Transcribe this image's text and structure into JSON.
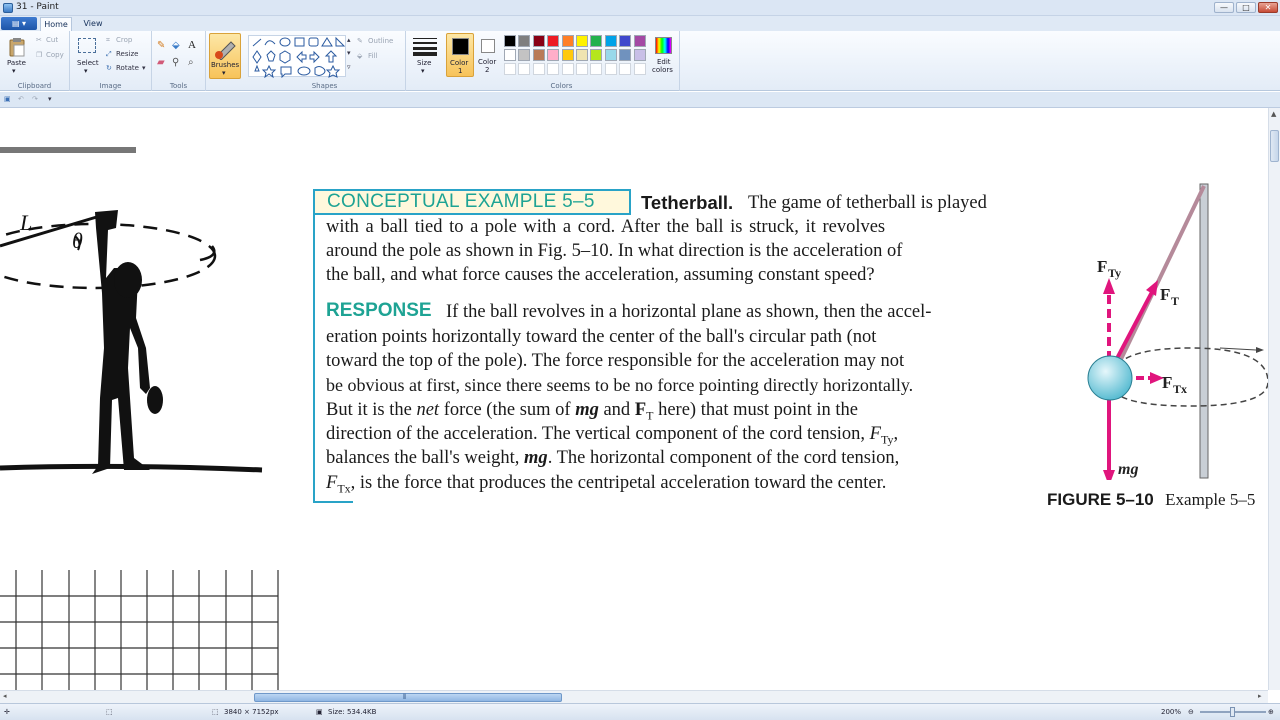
{
  "window": {
    "title": "31 - Paint",
    "minimize": "—",
    "maximize": "□",
    "close": "✕"
  },
  "tabs": [
    {
      "label": "Home",
      "active": true
    },
    {
      "label": "View",
      "active": false
    }
  ],
  "ribbon": {
    "clipboard": {
      "label": "Clipboard",
      "paste": "Paste",
      "cut": "Cut",
      "copy": "Copy"
    },
    "image": {
      "label": "Image",
      "select": "Select",
      "crop": "Crop",
      "resize": "Resize",
      "rotate": "Rotate"
    },
    "tools": {
      "label": "Tools"
    },
    "brushes": {
      "label": "Brushes"
    },
    "shapes": {
      "label": "Shapes",
      "outline": "Outline",
      "fill": "Fill"
    },
    "size": {
      "label": "Size"
    },
    "colors": {
      "label": "Colors",
      "color1": "Color 1",
      "color1_line2": "1",
      "color1_prefix": "Color",
      "color2_prefix": "Color",
      "color2_line2": "2",
      "edit_colors": "Edit colors",
      "edit_line1": "Edit",
      "edit_line2": "colors",
      "palette_row1": [
        "#000000",
        "#7f7f7f",
        "#880015",
        "#ed1c24",
        "#ff7f27",
        "#fff200",
        "#22b14c",
        "#00a2e8",
        "#3f48cc",
        "#a349a4"
      ],
      "palette_row2": [
        "#ffffff",
        "#c3c3c3",
        "#b97a57",
        "#ffaec9",
        "#ffc90e",
        "#efe4b0",
        "#b5e61d",
        "#99d9ea",
        "#7092be",
        "#c8bfe7"
      ]
    }
  },
  "document": {
    "concept_title": "CONCEPTUAL EXAMPLE 5–5",
    "tetherball_heading": "Tetherball.",
    "paragraph1": [
      "The game of tetherball is played",
      "with a ball tied to a pole with a cord. After the ball is struck, it revolves",
      "around the pole as shown in Fig. 5–10. In what direction is the acceleration of",
      "the ball, and what force causes the acceleration, assuming constant speed?"
    ],
    "response_label": "RESPONSE",
    "paragraph2": [
      "If the ball revolves in a horizontal plane as shown, then the accel-",
      "eration points horizontally toward the center of the ball's circular path (not",
      "toward the top of the pole). The force responsible for the acceleration may not",
      "be obvious at first, since there seems to be no force pointing directly horizontally.",
      "But it is the",
      "net",
      "force (the sum of",
      "mg",
      "and",
      "F",
      "T",
      "here) that must point in the",
      "direction of the acceleration. The vertical component of the cord tension,",
      "F",
      "Ty",
      ",",
      "balances the ball's weight,",
      "mg",
      ". The horizontal component of the cord tension,",
      "F",
      "Tx",
      ", is the force that produces the centripetal acceleration toward the center."
    ],
    "figure": {
      "caption_label": "FIGURE 5–10",
      "caption_text": "Example 5–5",
      "label_fty": "F",
      "label_fty_sub": "Ty",
      "label_ft": "F",
      "label_ft_sub": "T",
      "label_ftx": "F",
      "label_ftx_sub": "Tx",
      "label_mg": "mg"
    },
    "sketch_labels": {
      "L": "L",
      "theta": "θ"
    }
  },
  "status": {
    "dimensions": "3840 × 7152px",
    "size": "Size: 534.4KB",
    "zoom": "200%"
  }
}
